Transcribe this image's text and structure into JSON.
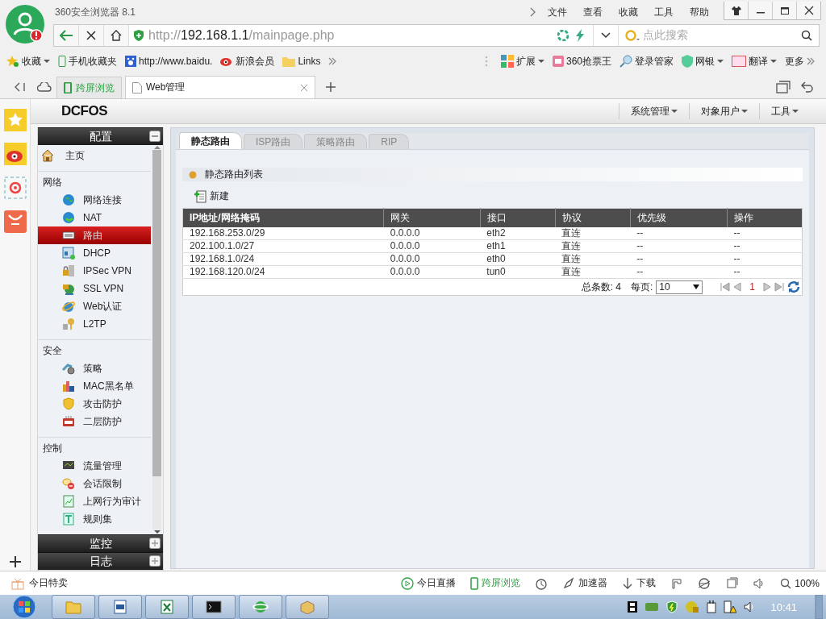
{
  "browser": {
    "title": "360安全浏览器 8.1",
    "menu": [
      "文件",
      "查看",
      "收藏",
      "工具",
      "帮助"
    ],
    "address": {
      "scheme": "http://",
      "host": "192.168.1.1",
      "path": "/mainpage.php"
    },
    "search": {
      "placeholder": "点此搜索"
    },
    "bookmarks": [
      "收藏",
      "手机收藏夹",
      "http://www.baidu.",
      "新浪会员",
      "Links"
    ],
    "extensions": [
      "扩展",
      "360抢票王",
      "登录管家",
      "网银",
      "翻译",
      "更多"
    ],
    "tabs": [
      {
        "label": "跨屏浏览",
        "kind": "pinned",
        "selected": false
      },
      {
        "label": "Web管理",
        "kind": "page",
        "selected": true
      }
    ]
  },
  "app": {
    "logo": "DCFOS",
    "menus": [
      "系统管理",
      "对象用户",
      "工具"
    ]
  },
  "sidebar": {
    "panels": [
      {
        "title": "配置",
        "expanded": true,
        "groups": [
          {
            "items": [
              {
                "label": "主页",
                "selected": false
              }
            ]
          },
          {
            "label": "网络",
            "items": [
              {
                "label": "网络连接",
                "selected": false
              },
              {
                "label": "NAT",
                "selected": false
              },
              {
                "label": "路由",
                "selected": true
              },
              {
                "label": "DHCP",
                "selected": false
              },
              {
                "label": "IPSec VPN",
                "selected": false
              },
              {
                "label": "SSL VPN",
                "selected": false
              },
              {
                "label": "Web认证",
                "selected": false
              },
              {
                "label": "L2TP",
                "selected": false
              }
            ]
          },
          {
            "label": "安全",
            "items": [
              {
                "label": "策略",
                "selected": false
              },
              {
                "label": "MAC黑名单",
                "selected": false
              },
              {
                "label": "攻击防护",
                "selected": false
              },
              {
                "label": "二层防护",
                "selected": false
              }
            ]
          },
          {
            "label": "控制",
            "items": [
              {
                "label": "流量管理",
                "selected": false
              },
              {
                "label": "会话限制",
                "selected": false
              },
              {
                "label": "上网行为审计",
                "selected": false
              },
              {
                "label": "规则集",
                "selected": false
              }
            ]
          }
        ]
      },
      {
        "title": "监控",
        "expanded": false
      },
      {
        "title": "日志",
        "expanded": false
      }
    ]
  },
  "main": {
    "tabs": [
      {
        "label": "静态路由",
        "selected": true
      },
      {
        "label": "ISP路由",
        "selected": false
      },
      {
        "label": "策略路由",
        "selected": false
      },
      {
        "label": "RIP",
        "selected": false
      }
    ],
    "section_title": "静态路由列表",
    "new_button": "新建",
    "table": {
      "columns": [
        "IP地址/网络掩码",
        "网关",
        "接口",
        "协议",
        "优先级",
        "操作"
      ],
      "rows": [
        [
          "192.168.253.0/29",
          "0.0.0.0",
          "eth2",
          "直连",
          "--",
          "--"
        ],
        [
          "202.100.1.0/27",
          "0.0.0.0",
          "eth1",
          "直连",
          "--",
          "--"
        ],
        [
          "192.168.1.0/24",
          "0.0.0.0",
          "eth0",
          "直连",
          "--",
          "--"
        ],
        [
          "192.168.120.0/24",
          "0.0.0.0",
          "tun0",
          "直连",
          "--",
          "--"
        ]
      ]
    },
    "pager": {
      "total": "总条数: 4",
      "per_page_label": "每页:",
      "per_page": "10",
      "page": "1"
    }
  },
  "status_bar": {
    "left": "今日特卖",
    "items": [
      {
        "label": "今日直播",
        "highlighted": false
      },
      {
        "label": "跨屏浏览",
        "highlighted": true
      },
      {
        "label": "加速器",
        "highlighted": false
      },
      {
        "label": "下载",
        "highlighted": false
      }
    ],
    "zoom": "100%"
  },
  "taskbar": {
    "clock": "10:41"
  }
}
